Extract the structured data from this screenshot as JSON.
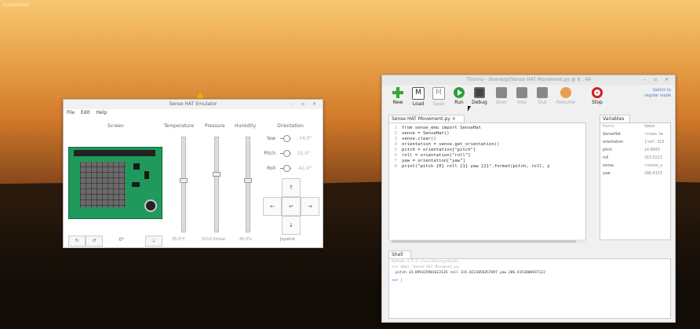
{
  "desktop": {
    "corner_label": "screenshot"
  },
  "emulator": {
    "title": "Sense HAT Emulator",
    "window_controls": "- ▫ ×",
    "menu": [
      "File",
      "Edit",
      "Help"
    ],
    "columns": {
      "screen": "Screen",
      "temperature": "Temperature",
      "pressure": "Pressure",
      "humidity": "Humidity",
      "orientation": "Orientation"
    },
    "orientation": [
      {
        "label": "Yaw",
        "value": "-74.0°"
      },
      {
        "label": "Pitch",
        "value": "15.0°"
      },
      {
        "label": "Roll",
        "value": "-41.0°"
      }
    ],
    "joystick": {
      "up": "↑",
      "left": "←",
      "center": "↵",
      "right": "→",
      "down": "↓",
      "label": "Joystick"
    },
    "bottom_buttons": [
      "↻",
      "↺",
      "0°",
      "⊥"
    ],
    "slider_values": {
      "temperature": "25.0°C",
      "pressure": "1013.0mbar",
      "humidity": "45.0%"
    },
    "slider_levels": {
      "temperature": 0.55,
      "pressure": 0.62,
      "humidity": 0.55
    }
  },
  "thonny": {
    "title": "Thonny  -  /home/pi/Sense HAT Movement.py  @  8 : 49",
    "window_controls": "- ▫ ×",
    "toolbar": [
      {
        "label": "New",
        "icon": "plus-icon",
        "color": "#3aa53a",
        "enabled": true
      },
      {
        "label": "Load",
        "icon": "load-icon",
        "color": "#555555",
        "enabled": true
      },
      {
        "label": "Save",
        "icon": "save-icon",
        "color": "#555555",
        "enabled": false
      },
      {
        "label": "Run",
        "icon": "run-icon",
        "color": "#2e9e3e",
        "enabled": true
      },
      {
        "label": "Debug",
        "icon": "debug-icon",
        "color": "#444444",
        "enabled": true
      },
      {
        "label": "Over",
        "icon": "step-over-icon",
        "color": "#777777",
        "enabled": false
      },
      {
        "label": "Into",
        "icon": "step-into-icon",
        "color": "#777777",
        "enabled": false
      },
      {
        "label": "Out",
        "icon": "step-out-icon",
        "color": "#777777",
        "enabled": false
      },
      {
        "label": "Resume",
        "icon": "resume-icon",
        "color": "#e8a050",
        "enabled": false
      },
      {
        "label": "Stop",
        "icon": "stop-icon",
        "color": "#d22020",
        "enabled": true
      }
    ],
    "support": [
      "Switch to",
      "regular mode"
    ],
    "editor_tab": "Sense HAT Movement.py ×",
    "code": [
      "from sense_emu import SenseHat",
      "sense = SenseHat()",
      "sense.clear()",
      "orientation = sense.get_orientation()",
      "pitch = orientation[\"pitch\"]",
      "roll = orientation[\"roll\"]",
      "yaw = orientation[\"yaw\"]",
      "print(\"pitch {0} roll {1} yaw {2}\".format(pitch, roll, y"
    ],
    "variables_tab": "Variables",
    "variables_header": {
      "name": "Name",
      "value": "Value"
    },
    "variables": [
      {
        "name": "SenseHat",
        "value": "<class 'se"
      },
      {
        "name": "orientation",
        "value": "{'roll': 315"
      },
      {
        "name": "pitch",
        "value": "14.8993"
      },
      {
        "name": "roll",
        "value": "315.0223"
      },
      {
        "name": "sense",
        "value": "<sense_e"
      },
      {
        "name": "yaw",
        "value": "286.4153"
      }
    ],
    "shell_tab": "Shell",
    "shell": {
      "line1": "Python 3.7.3 (/usr/bin/python3)",
      "line2": ">>> %Run 'Sense HAT Movement.py'",
      "output": "pitch 14.899325981622126 roll 315.0223050357097 yaw 286.4153800937122",
      "prompt": ">>>"
    }
  }
}
